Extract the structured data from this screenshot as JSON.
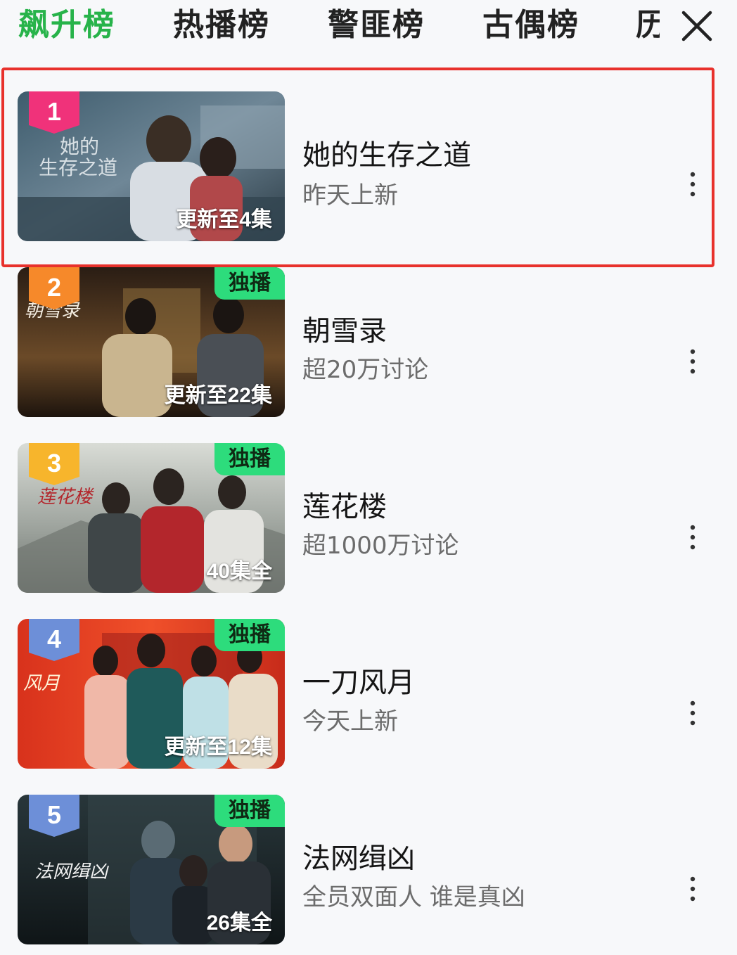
{
  "tabs": [
    {
      "label": "飙升榜",
      "active": true
    },
    {
      "label": "热播榜",
      "active": false
    },
    {
      "label": "警匪榜",
      "active": false
    },
    {
      "label": "古偶榜",
      "active": false
    },
    {
      "label": "历",
      "active": false
    }
  ],
  "close_icon": "close-icon",
  "colors": {
    "accent": "#27b34a",
    "highlight": "#e8312c",
    "exclusive_badge": "#2ddc7c",
    "rank_1": "#f0327a",
    "rank_2": "#f6892a",
    "rank_3": "#f7b52c",
    "rank_4_5": "#6d8fd8"
  },
  "items": [
    {
      "rank": "1",
      "title": "她的生存之道",
      "subtitle": "昨天上新",
      "badge": "",
      "update": "更新至4集",
      "highlighted": true
    },
    {
      "rank": "2",
      "title": "朝雪录",
      "subtitle": "超20万讨论",
      "badge": "独播",
      "update": "更新至22集",
      "highlighted": false
    },
    {
      "rank": "3",
      "title": "莲花楼",
      "subtitle": "超1000万讨论",
      "badge": "独播",
      "update": "40集全",
      "highlighted": false
    },
    {
      "rank": "4",
      "title": "一刀风月",
      "subtitle": "今天上新",
      "badge": "独播",
      "update": "更新至12集",
      "highlighted": false
    },
    {
      "rank": "5",
      "title": "法网缉凶",
      "subtitle": "全员双面人 谁是真凶",
      "badge": "独播",
      "update": "26集全",
      "highlighted": false
    }
  ]
}
